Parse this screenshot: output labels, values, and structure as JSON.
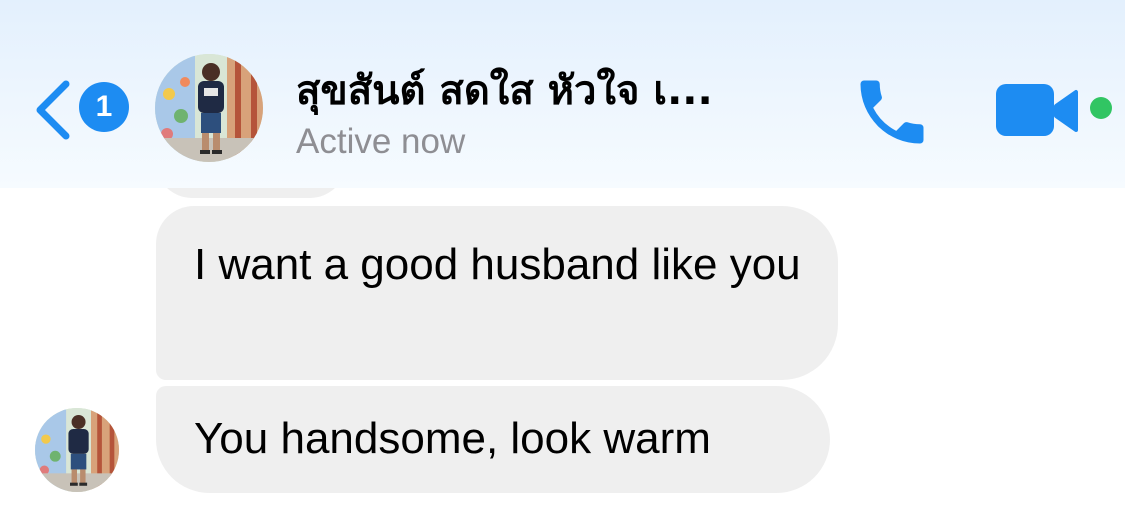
{
  "header": {
    "unread_count": "1",
    "contact_name": "สุขสันต์ สดใส หัวใจ เ...",
    "status": "Active now",
    "accent_color": "#1d8cf2",
    "active_dot_color": "#31c563",
    "icons": {
      "back": "chevron-left-icon",
      "call": "phone-icon",
      "video": "video-camera-icon"
    }
  },
  "messages": [
    {
      "text": "I want a good husband like you"
    },
    {
      "text": "You handsome, look warm"
    }
  ],
  "colors": {
    "incoming_bubble": "#efefef",
    "header_background": "#eaf4fe",
    "status_text": "#8e8e93"
  }
}
